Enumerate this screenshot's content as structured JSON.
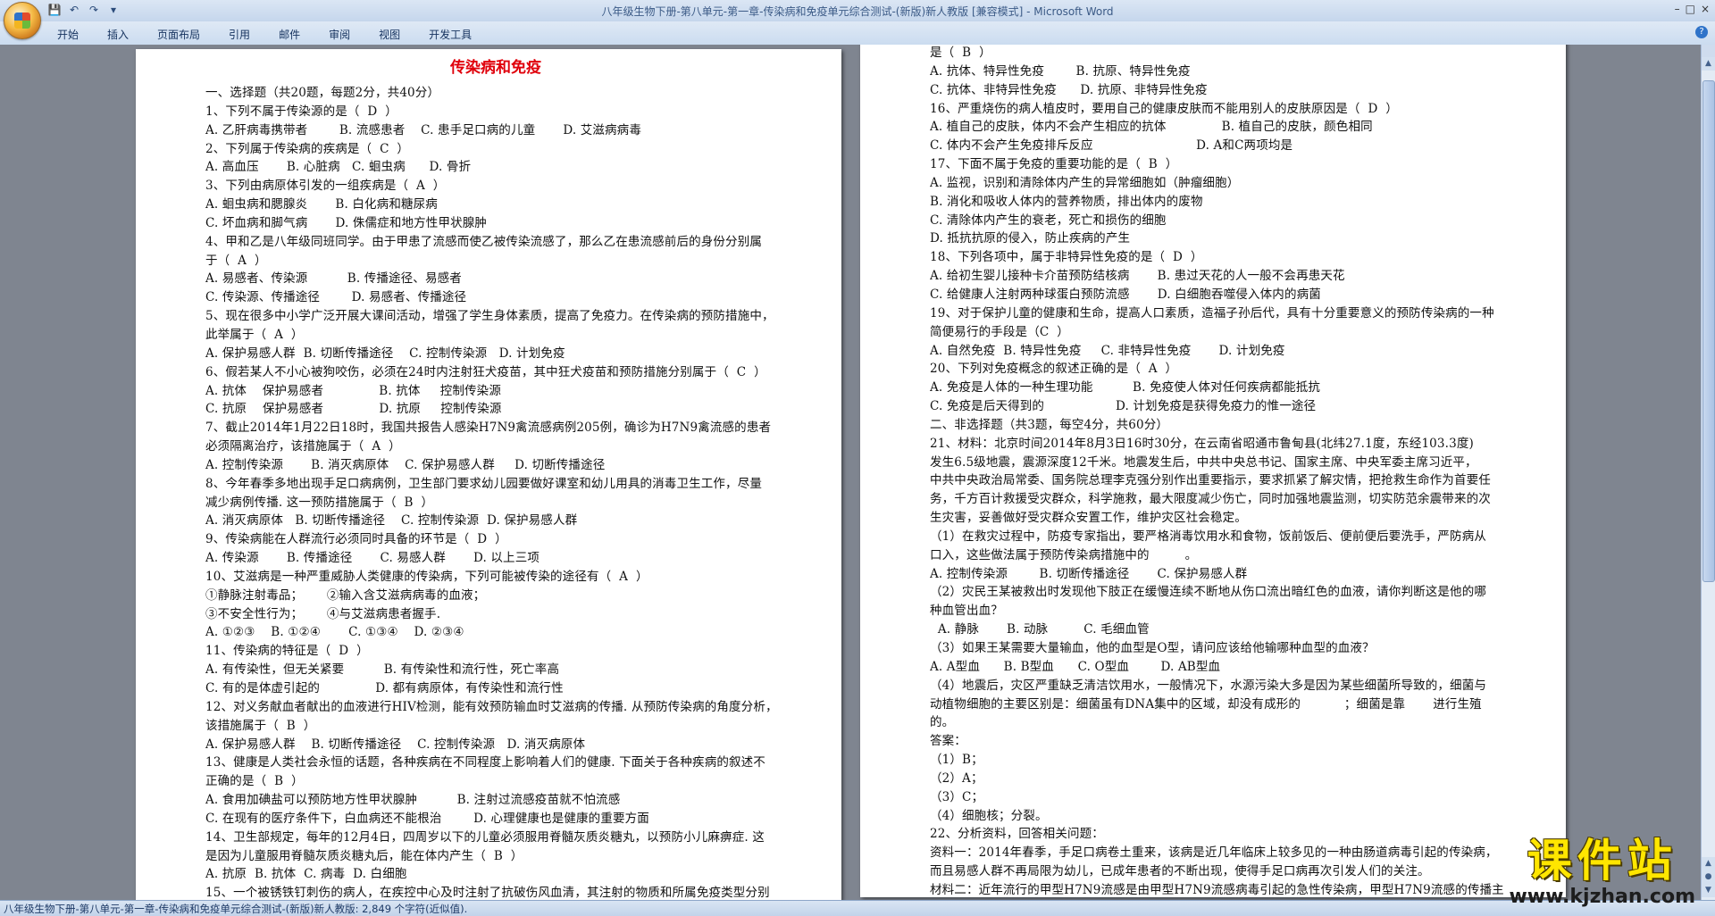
{
  "window": {
    "title": "八年级生物下册-第八单元-第一章-传染病和免疫单元综合测试-(新版)新人教版 [兼容模式] - Microsoft Word",
    "controls": [
      "–",
      "□",
      "×"
    ]
  },
  "quick_access": [
    {
      "icon": "save-icon",
      "glyph": "💾"
    },
    {
      "icon": "undo-icon",
      "glyph": "↶"
    },
    {
      "icon": "redo-icon",
      "glyph": "↷"
    },
    {
      "icon": "customize-icon",
      "glyph": "▾"
    }
  ],
  "ribbon": {
    "tabs": [
      "开始",
      "插入",
      "页面布局",
      "引用",
      "邮件",
      "审阅",
      "视图",
      "开发工具"
    ]
  },
  "document": {
    "title": "传染病和免疫",
    "left_page_lines": [
      "一、选择题（共20题，每题2分，共40分）",
      "1、下列不属于传染源的是（  D  ）",
      "A. 乙肝病毒携带者        B. 流感患者    C. 患手足口病的儿童       D. 艾滋病病毒",
      "2、下列属于传染病的疾病是（  C  ）",
      "A. 高血压       B. 心脏病   C. 蛔虫病      D. 骨折",
      "3、下列由病原体引发的一组疾病是（  A  ）",
      "A. 蛔虫病和腮腺炎       B. 白化病和糖尿病",
      "C. 坏血病和脚气病       D. 侏儒症和地方性甲状腺肿",
      "4、甲和乙是八年级同班同学。由于甲患了流感而使乙被传染流感了，那么乙在患流感前后的身份分别属",
      "于（  A  ）",
      "A. 易感者、传染源          B. 传播途径、易感者",
      "C. 传染源、传播途径        D. 易感者、传播途径",
      "5、现在很多中小学广泛开展大课间活动，增强了学生身体素质，提高了免疫力。在传染病的预防措施中，",
      "此举属于（  A  ）",
      "A. 保护易感人群  B. 切断传播途径    C. 控制传染源   D. 计划免疫",
      "6、假若某人不小心被狗咬伤，必须在24时内注射狂犬疫苗，其中狂犬疫苗和预防措施分别属于（  C  ）",
      "A. 抗体    保护易感者              B. 抗体     控制传染源",
      "C. 抗原    保护易感者              D. 抗原     控制传染源",
      "7、截止2014年1月22日18时，我国共报告人感染H7N9禽流感病例205例，确诊为H7N9禽流感的患者",
      "必须隔离治疗，该措施属于（  A  ）",
      "A. 控制传染源       B. 消灭病原体    C. 保护易感人群     D. 切断传播途径",
      "8、今年春季多地出现手足口病病例，卫生部门要求幼儿园要做好课室和幼儿用具的消毒卫生工作，尽量",
      "减少病例传播. 这一预防措施属于（  B  ）",
      "A. 消灭病原体   B. 切断传播途径    C. 控制传染源  D. 保护易感人群",
      "9、传染病能在人群流行必须同时具备的环节是（  D  ）",
      "A. 传染源       B. 传播途径       C. 易感人群       D. 以上三项",
      "10、艾滋病是一种严重威胁人类健康的传染病，下列可能被传染的途径有（  A  ）",
      "①静脉注射毒品；      ②输入含艾滋病病毒的血液；",
      "③不安全性行为；      ④与艾滋病患者握手.",
      "A. ①②③    B. ①②④       C. ①③④    D. ②③④",
      "11、传染病的特征是（  D  ）",
      "A. 有传染性，但无关紧要          B. 有传染性和流行性，死亡率高",
      "C. 有的是体虚引起的              D. 都有病原体，有传染性和流行性",
      "12、对义务献血者献出的血液进行HIV检测，能有效预防输血时艾滋病的传播. 从预防传染病的角度分析，",
      "该措施属于（  B  ）",
      "A. 保护易感人群    B. 切断传播途径    C. 控制传染源   D. 消灭病原体",
      "13、健康是人类社会永恒的话题，各种疾病在不同程度上影响着人们的健康. 下面关于各种疾病的叙述不",
      "正确的是（  B  ）",
      "A. 食用加碘盐可以预防地方性甲状腺肿          B. 注射过流感疫苗就不怕流感",
      "C. 在现有的医疗条件下，白血病还不能根治        D. 心理健康也是健康的重要方面",
      "14、卫生部规定，每年的12月4日，四周岁以下的儿童必须服用脊髓灰质炎糖丸，以预防小儿麻痹症. 这",
      "是因为儿童服用脊髓灰质炎糖丸后，能在体内产生（  B  ）",
      "A. 抗原  B. 抗体  C. 病毒  D. 白细胞",
      "15、一个被锈铁钉刺伤的病人，在疾控中心及时注射了抗破伤风血清，其注射的物质和所属免疫类型分别"
    ],
    "right_page_lines": [
      "是（  B  ）",
      "A. 抗体、特异性免疫        B. 抗原、特异性免疫",
      "C. 抗体、非特异性免疫      D. 抗原、非特异性免疫",
      "16、严重烧伤的病人植皮时，要用自己的健康皮肤而不能用别人的皮肤原因是（  D  ）",
      "A. 植自己的皮肤，体内不会产生相应的抗体              B. 植自己的皮肤，颜色相同",
      "C. 体内不会产生免疫排斥反应                          D. A和C两项均是",
      "17、下面不属于免疫的重要功能的是（  B  ）",
      "A. 监视，识别和清除体内产生的异常细胞如（肿瘤细胞）",
      "B. 消化和吸收人体内的营养物质，排出体内的废物",
      "C. 清除体内产生的衰老，死亡和损伤的细胞",
      "D. 抵抗抗原的侵入，防止疾病的产生",
      "18、下列各项中，属于非特异性免疫的是（  D  ）",
      "A. 给初生婴儿接种卡介苗预防结核病       B. 患过天花的人一般不会再患天花",
      "C. 给健康人注射两种球蛋白预防流感       D. 白细胞吞噬侵入体内的病菌",
      "19、对于保护儿童的健康和生命，提高人口素质，造福子孙后代，具有十分重要意义的预防传染病的一种",
      "简便易行的手段是（C  ）",
      "A. 自然免疫  B. 特异性免疫     C. 非特异性免疫       D. 计划免疫",
      "20、下列对免疫概念的叙述正确的是（  A  ）",
      "A. 免疫是人体的一种生理功能          B. 免疫使人体对任何疾病都能抵抗",
      "C. 免疫是后天得到的                  D. 计划免疫是获得免疫力的惟一途径",
      "二、非选择题（共3题，每空4分，共60分）",
      "21、材料：北京时间2014年8月3日16时30分，在云南省昭通市鲁甸县(北纬27.1度，东经103.3度)",
      "发生6.5级地震，震源深度12千米。地震发生后，中共中央总书记、国家主席、中央军委主席习近平，",
      "中共中央政治局常委、国务院总理李克强分别作出重要指示，要求抓紧了解灾情，把抢救生命作为首要任",
      "务，千方百计救援受灾群众，科学施救，最大限度减少伤亡，同时加强地震监测，切实防范余震带来的次",
      "生灾害，妥善做好受灾群众安置工作，维护灾区社会稳定。",
      "（1）在救灾过程中，防疫专家指出，要严格消毒饮用水和食物，饭前饭后、便前便后要洗手，严防病从",
      "口入，这些做法属于预防传染病措施中的         。",
      "A. 控制传染源        B. 切断传播途径       C. 保护易感人群",
      "（2）灾民王某被救出时发现他下肢正在缓慢连续不断地从伤口流出暗红色的血液，请你判断这是他的哪",
      "种血管出血？",
      "  A. 静脉       B. 动脉         C. 毛细血管",
      "（3）如果王某需要大量输血，他的血型是O型，请问应该给他输哪种血型的血液？",
      "A. A型血      B. B型血      C. O型血        D. AB型血",
      "（4）地震后，灾区严重缺乏清洁饮用水，一般情况下，水源污染大多是因为某些细菌所导致的，细菌与",
      "动植物细胞的主要区别是：细菌虽有DNA集中的区域，却没有成形的           ；细菌是靠       进行生殖",
      "的。",
      "答案：",
      "（1）B；",
      "（2）A；",
      "（3）C；",
      "（4）细胞核；分裂。",
      "22、分析资料，回答相关问题：",
      "资料一：2014年春季，手足口病卷土重来，该病是近几年临床上较多见的一种由肠道病毒引起的传染病，",
      "而且易感人群不再局限为幼儿，已成年患者的不断出现，使得手足口病再次引发人们的关注。",
      "材料二：近年流行的甲型H7N9流感是由甲型H7N9流感病毒引起的急性传染病，甲型H7N9流感的传播主"
    ]
  },
  "statusbar": {
    "text": "八年级生物下册-第八单元-第一章-传染病和免疫单元综合测试-(新版)新人教版: 2,849 个字符(近似值)."
  },
  "watermark": {
    "cn": "课件站",
    "url": "www.kjzhan.com"
  }
}
